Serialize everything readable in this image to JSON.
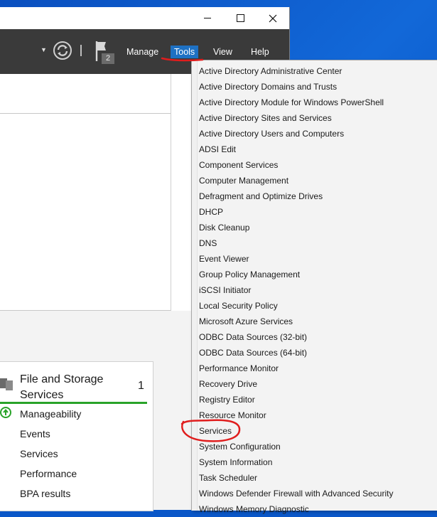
{
  "toolbar": {
    "menu": [
      "Manage",
      "Tools",
      "View",
      "Help"
    ],
    "notification_count": "2"
  },
  "tile": {
    "title": "File and Storage Services",
    "count": "1",
    "rows": [
      "Manageability",
      "Events",
      "Services",
      "Performance",
      "BPA results"
    ],
    "status_color": "#29a329"
  },
  "tools_menu": {
    "items": [
      "Active Directory Administrative Center",
      "Active Directory Domains and Trusts",
      "Active Directory Module for Windows PowerShell",
      "Active Directory Sites and Services",
      "Active Directory Users and Computers",
      "ADSI Edit",
      "Component Services",
      "Computer Management",
      "Defragment and Optimize Drives",
      "DHCP",
      "Disk Cleanup",
      "DNS",
      "Event Viewer",
      "Group Policy Management",
      "iSCSI Initiator",
      "Local Security Policy",
      "Microsoft Azure Services",
      "ODBC Data Sources (32-bit)",
      "ODBC Data Sources (64-bit)",
      "Performance Monitor",
      "Recovery Drive",
      "Registry Editor",
      "Resource Monitor",
      "Services",
      "System Configuration",
      "System Information",
      "Task Scheduler",
      "Windows Defender Firewall with Advanced Security",
      "Windows Memory Diagnostic"
    ]
  },
  "colors": {
    "accent": "#1e71c4",
    "annotation": "#e01d1d",
    "toolbar_bg": "#3a3a3a"
  }
}
